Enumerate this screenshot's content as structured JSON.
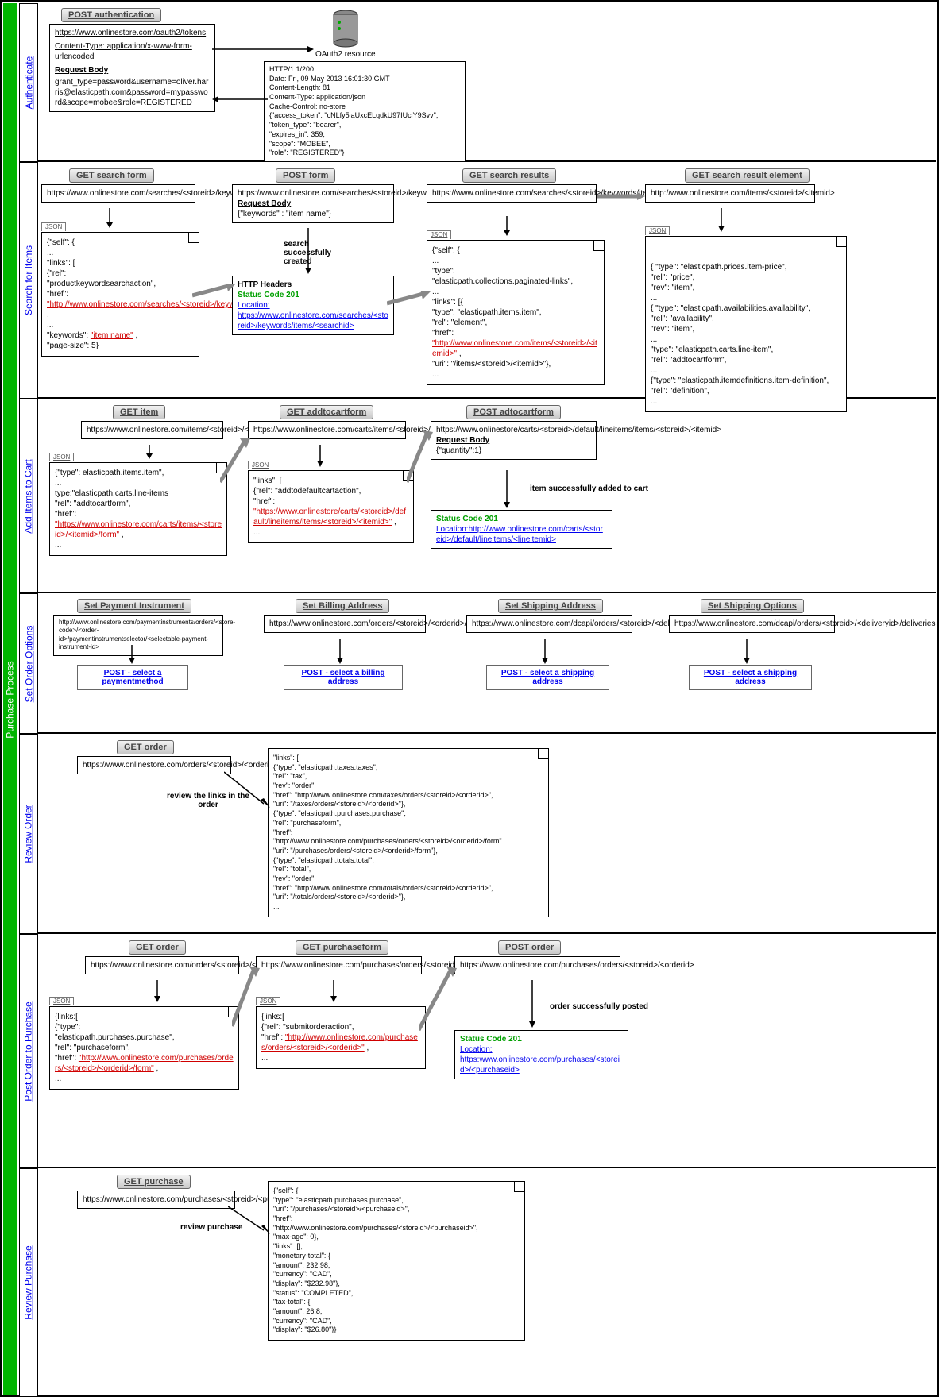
{
  "process_title": "Purchase Process",
  "sections": {
    "auth": {
      "label": "Authenticate",
      "btn": "POST authentication",
      "req_url": "https://www.onlinestore.com/oauth2/tokens",
      "req_ct": "Content-Type: application/x-www-form-urlencoded",
      "req_body_label": "Request Body",
      "req_body": "grant_type=password&username=oliver.harris@elasticpath.com&password=mypassword&scope=mobee&role=REGISTERED",
      "server_label": "OAuth2 resource",
      "resp": "HTTP/1.1/200\nDate: Fri, 09 May 2013 16:01:30 GMT\nContent-Length: 81\nContent-Type: application/json\nCache-Control: no-store\n{\"access_token\": \"cNLfy5iaUxcELqdkU97IUclY9Svv\",\n\"token_type\": \"bearer\",\n\"expires_in\": 359,\n\"scope\": \"MOBEE\",\n\"role\": \"REGISTERED\"}"
    },
    "search": {
      "label": "Search for Items",
      "b1": "GET search form",
      "u1": "https://www.onlinestore.com/searches/<storeid>/keywords/form",
      "j1a": "{\"self\": {\n...\n\"links\": [\n{\"rel\":\n\"productkeywordsearchaction\",\n\"href\":",
      "j1_link": "\"http://www.onlinestore.com/searches/<storeid>/keywords/items\"",
      "j1b": ",\n...\n\"keywords\": ",
      "j1_link2": "\"item name\"",
      "j1c": ",\n\"page-size\": 5}",
      "b2": "POST form",
      "u2": "https://www.onlinestore.com/searches/<storeid>/keywords/items",
      "rb2": "Request Body",
      "rb2v": "{\"keywords\" : \"item name\"}",
      "msg2": "search successfully created",
      "hh": "HTTP Headers",
      "sc201": "Status Code 201",
      "loc": "Location:",
      "loc2": "https://www.onlinestore.com/searches/<storeid>/keywords/items/<searchid>",
      "b3": "GET search results",
      "u3": "https://www.onlinestore.com/searches/<storeid>/keywords/items/<searchid>",
      "j3a": "{\"self\": {\n...\n\"type\":\n\"elasticpath.collections.paginated-links\",\n...\n\"links\": [{\n\"type\": \"elasticpath.items.item\",\n\"rel\": \"element\",\n\"href\":",
      "j3_link": "\"http://www.onlinestore.com/items/<storeid>/<itemid>\"",
      "j3b": ",\n\"uri\": \"/items/<storeid>/<itemid>\"},\n...",
      "b4": "GET search result element",
      "u4": "http://www.onlinestore.com/items/<storeid>/<itemid>",
      "j4": "{ \"type\": \"elasticpath.prices.item-price\",\n  \"rel\": \"price\",\n  \"rev\": \"item\",\n...\n{ \"type\": \"elasticpath.availabilities.availability\",\n  \"rel\": \"availability\",\n  \"rev\": \"item\",\n...\n  \"type\": \"elasticpath.carts.line-item\",\n  \"rel\": \"addtocartform\",\n...\n{\"type\": \"elasticpath.itemdefinitions.item-definition\",\n  \"rel\": \"definition\",\n..."
    },
    "cart": {
      "label": "Add Items to Cart",
      "b1": "GET item",
      "u1": "https://www.onlinestore.com/items/<storeid>/<itemid>",
      "j1a": "{\"type\": elasticpath.items.item\",\n...\ntype:\"elasticpath.carts.line-items\n\"rel\": \"addtocartform\",\n\"href\":",
      "j1_link": "\"https://www.onlinestore.com/carts/items/<storeid>/<itemid>/form\"",
      "j1b": ",\n...",
      "b2": "GET addtocartform",
      "u2": "https://www.onlinestore.com/carts/items/<storeid>/<itemid>/form",
      "j2a": "\"links\": [\n{\"rel\": \"addtodefaultcartaction\",\n\"href\":",
      "j2_link": "\"https://www.onlinestore/carts/<storeid>/default/lineitems/items/<storeid>/<itemid>\"",
      "j2b": ",\n...",
      "b3": "POST adtocartform",
      "u3": "https://www.onlinestore/carts/<storeid>/default/lineitems/items/<storeid>/<itemid>",
      "rb3": "Request Body",
      "rb3v": "{\"quantity\":1}",
      "msg3": "item successfully added to cart",
      "loc3": "Location:http://www.onlinestore.com/carts/<storeid>/default/lineitems/<lineitemid>"
    },
    "opts": {
      "label": "Set Order Options",
      "b1": "Set Payment Instrument",
      "u1": "http://www.onlinestore.com/paymentinstruments/orders/<store-code>/<order-id>/paymentinstrumentselector/<selectable-payment-instrument-id>",
      "p1": "POST - select a paymentmethod",
      "b2": "Set Billing Address",
      "u2": "https://www.onlinestore.com/orders/<storeid>/<orderid>/billinginfo",
      "p2": "POST - select a billing address",
      "b3": "Set Shipping Address",
      "u3": "https://www.onlinestore.com/dcapi/orders/<storeid>/<deliveryid>/deliveries",
      "p3": "POST - select a shipping address",
      "b4": "Set Shipping Options",
      "u4": "https://www.onlinestore.com/dcapi/orders/<storeid>/<deliveryid>/deliveries",
      "p4": "POST - select a shipping address"
    },
    "review": {
      "label": "Review Order",
      "b1": "GET order",
      "u1": "https://www.onlinestore.com/orders/<storeid>/<orderid>",
      "msg": "review the links in the order",
      "j": "\"links\": [\n{\"type\": \"elasticpath.taxes.taxes\",\n\"rel\": \"tax\",\n\"rev\": \"order\",\n\"href\": \"http://www.onlinestore.com/taxes/orders/<storeid>/<orderid>\",\n\"uri\": \"/taxes/orders/<storeid>/<orderid>\"},\n{\"type\": \"elasticpath.purchases.purchase\",\n\"rel\": \"purchaseform\",\n\"href\":\n\"http://www.onlinestore.com/purchases/orders/<storeid>/<orderid>/form\"\n\"uri\": \"/purchases/orders/<storeid>/<orderid>/form\"},\n{\"type\": \"elasticpath.totals.total\",\n\"rel\": \"total\",\n\"rev\": \"order\",\n\"href\": \"http://www.onlinestore.com/totals/orders/<storeid>/<orderid>\",\n\"uri\": \"/totals/orders/<storeid>/<orderid>\"},\n..."
    },
    "post": {
      "label": "Post Order to Purchase",
      "b1": "GET order",
      "u1": "https://www.onlinestore.com/orders/<storeid>/<orderid>",
      "j1a": "{links:[\n{\"type\":\n\"elasticpath.purchases.purchase\",\n\"rel\": \"purchaseform\",\n\"href\":",
      "j1_link": "\"http://www.onlinestore.com/purchases/orders/<storeid>/<orderid>/form\"",
      "j1b": ",\n...",
      "b2": "GET purchaseform",
      "u2": "https://www.onlinestore.com/purchases/orders/<storeid>/<orderid>/form",
      "j2a": "{links:[\n{\"rel\": \"submitorderaction\",\n\"href\":",
      "j2_link": "\"http://www.onlinestore.com/purchases/orders/<storeid>/<orderid>\"",
      "j2b": ",\n...",
      "b3": "POST order",
      "u3": "https://www.onlinestore.com/purchases/orders/<storeid>/<orderid>",
      "msg3": "order successfully posted",
      "loc3": "https:www.onlinestore.com/purchases/<storeid>/<purchaseid>"
    },
    "rp": {
      "label": "Review Purchase",
      "b1": "GET purchase",
      "u1": "https://www.onlinestore.com/purchases/<storeid>/<purchaseid>",
      "msg": "review purchase",
      "j": "{\"self\": {\n\"type\": \"elasticpath.purchases.purchase\",\n\"uri\": \"/purchases/<storeid>/<purchaseid>\",\n\"href\":\n\"http://www.onlinestore.com/purchases/<storeid>/<purchaseid>\",\n\"max-age\": 0},\n\"links\": [],\n\"monetary-total\": {\n\"amount\": 232.98,\n\"currency\": \"CAD\",\n\"display\": \"$232.98\"},\n\"status\": \"COMPLETED\",\n\"tax-total\": {\n\"amount\": 26.8,\n\"currency\": \"CAD\",\n\"display\": \"$26.80\"}}"
    }
  },
  "json_tab": "JSON"
}
